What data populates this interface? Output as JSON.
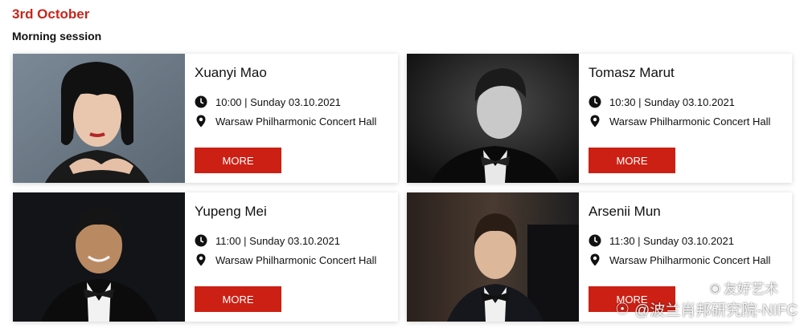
{
  "date_heading": "3rd October",
  "session_heading": "Morning session",
  "performers": [
    {
      "name": "Xuanyi Mao",
      "time": "10:00 | Sunday 03.10.2021",
      "venue": "Warsaw Philharmonic Concert Hall",
      "button": "MORE"
    },
    {
      "name": "Tomasz Marut",
      "time": "10:30 | Sunday 03.10.2021",
      "venue": "Warsaw Philharmonic Concert Hall",
      "button": "MORE"
    },
    {
      "name": "Yupeng Mei",
      "time": "11:00 | Sunday 03.10.2021",
      "venue": "Warsaw Philharmonic Concert Hall",
      "button": "MORE"
    },
    {
      "name": "Arsenii Mun",
      "time": "11:30 | Sunday 03.10.2021",
      "venue": "Warsaw Philharmonic Concert Hall",
      "button": "MORE"
    }
  ],
  "watermark": {
    "line1": "友好艺术",
    "line2": "@波兰肖邦研究院-NIFC"
  },
  "colors": {
    "accent": "#c9261c",
    "button": "#cc2014"
  },
  "icons": [
    "clock-icon",
    "map-pin-icon",
    "weibo-icon",
    "wechat-icon"
  ]
}
